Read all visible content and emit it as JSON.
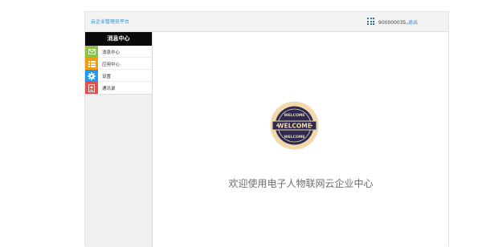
{
  "header": {
    "brand": "云企业管理员平台",
    "user_id": "900000035，",
    "logout_label": "退出"
  },
  "sidebar": {
    "title": "消息中心",
    "items": [
      {
        "label": "消息中心",
        "icon": "mail-icon",
        "color": "#8bc34a"
      },
      {
        "label": "应用中心",
        "icon": "list-icon",
        "color": "#f39c12"
      },
      {
        "label": "设置",
        "icon": "gear-icon",
        "color": "#2196f3"
      },
      {
        "label": "通讯录",
        "icon": "contacts-icon",
        "color": "#d9534f"
      }
    ]
  },
  "main": {
    "badge_text_top": "WELCOME",
    "badge_text_mid": "WELCOME",
    "badge_text_bottom": "WELCOME",
    "welcome_message": "欢迎使用电子人物联网云企业中心"
  },
  "colors": {
    "accent": "#2a8fd0",
    "badge_outer": "#f2d8ad",
    "badge_inner": "#2c2a52"
  }
}
